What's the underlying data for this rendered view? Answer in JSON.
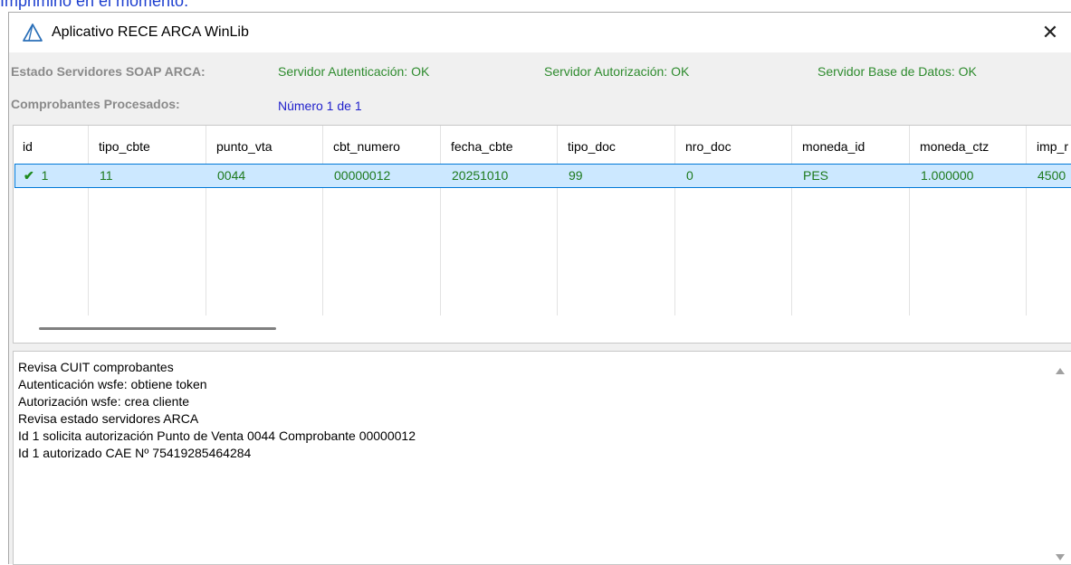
{
  "page_top_text": "Imprimirlo en el momento.",
  "window": {
    "title": "Aplicativo RECE ARCA WinLib",
    "icon": "app-triangle-icon",
    "close_glyph": "✕"
  },
  "status": {
    "servers_label": "Estado Servidores SOAP ARCA:",
    "auth_server": "Servidor Autenticación: OK",
    "authz_server": "Servidor Autorización: OK",
    "db_server": "Servidor Base de Datos: OK",
    "processed_label": "Comprobantes Procesados:",
    "processed_value": "Número 1 de 1"
  },
  "grid": {
    "columns": [
      "id",
      "tipo_cbte",
      "punto_vta",
      "cbt_numero",
      "fecha_cbte",
      "tipo_doc",
      "nro_doc",
      "moneda_id",
      "moneda_ctz",
      "imp_r"
    ],
    "rows": [
      {
        "status_icon": "checkmark-icon",
        "check_glyph": "✔",
        "cells": [
          "1",
          "11",
          "0044",
          "00000012",
          "20251010",
          "99",
          "0",
          "PES",
          "1.000000",
          "4500"
        ]
      }
    ]
  },
  "log": {
    "lines": [
      "Revisa CUIT comprobantes",
      "Autenticación wsfe: obtiene token",
      "Autorización wsfe: crea cliente",
      "Revisa estado servidores ARCA",
      "Id 1 solicita autorización Punto de Venta 0044 Comprobante 00000012",
      "Id 1 autorizado CAE Nº 75419285464284"
    ]
  },
  "colors": {
    "ok_green": "#2e8b2e",
    "selection_bg": "#cce8ff",
    "selection_border": "#0078d7",
    "link_blue": "#2222cc"
  }
}
